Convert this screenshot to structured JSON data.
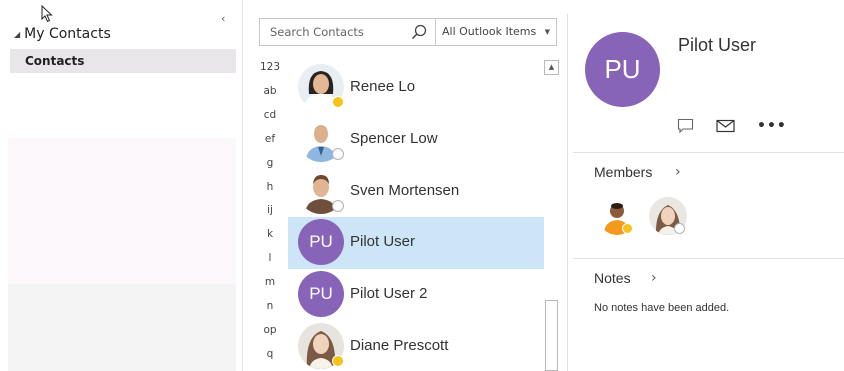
{
  "folder_pane": {
    "section_title": "My Contacts",
    "selected_folder": "Contacts",
    "collapse_glyph": "‹"
  },
  "search": {
    "placeholder": "Search Contacts",
    "scope": "All Outlook Items"
  },
  "alphabet_index": [
    "123",
    "ab",
    "cd",
    "ef",
    "g",
    "h",
    "ij",
    "k",
    "l",
    "m",
    "n",
    "op",
    "q"
  ],
  "contacts": [
    {
      "name": "Renee Lo",
      "avatar": "photo",
      "presence": "away",
      "selected": false
    },
    {
      "name": "Spencer Low",
      "avatar": "photo",
      "presence": "offline",
      "selected": false
    },
    {
      "name": "Sven Mortensen",
      "avatar": "photo",
      "presence": "offline",
      "selected": false
    },
    {
      "name": "Pilot User",
      "avatar": "initials",
      "initials": "PU",
      "presence": "none",
      "selected": true
    },
    {
      "name": "Pilot User 2",
      "avatar": "initials",
      "initials": "PU",
      "presence": "none",
      "selected": false
    },
    {
      "name": "Diane Prescott",
      "avatar": "photo",
      "presence": "away",
      "selected": false
    }
  ],
  "detail": {
    "initials": "PU",
    "name": "Pilot User",
    "actions": [
      "chat-icon",
      "mail-icon",
      "more-icon"
    ],
    "more_label": "•••",
    "members": {
      "heading": "Members",
      "chevron": "›",
      "people": [
        {
          "presence": "away"
        },
        {
          "presence": "offline"
        }
      ]
    },
    "notes": {
      "heading": "Notes",
      "chevron": "›",
      "text": "No notes have been added."
    }
  },
  "colors": {
    "accent_purple": "#8764b8",
    "selection_blue": "#cde6f7",
    "away_yellow": "#f8c21c",
    "offline_grey": "#b3b3b3"
  }
}
